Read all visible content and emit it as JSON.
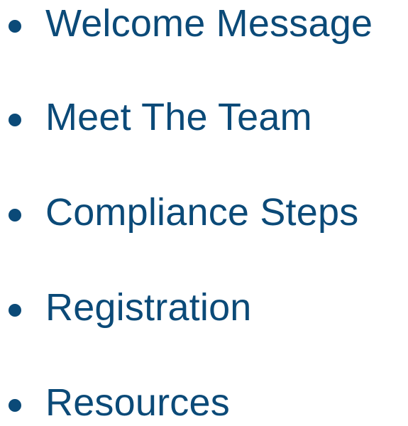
{
  "theme": {
    "text_color": "#0b4a78",
    "background": "#ffffff"
  },
  "nav": {
    "items": [
      {
        "label": "Welcome Message"
      },
      {
        "label": "Meet The Team"
      },
      {
        "label": "Compliance Steps"
      },
      {
        "label": "Registration"
      },
      {
        "label": "Resources"
      }
    ]
  }
}
